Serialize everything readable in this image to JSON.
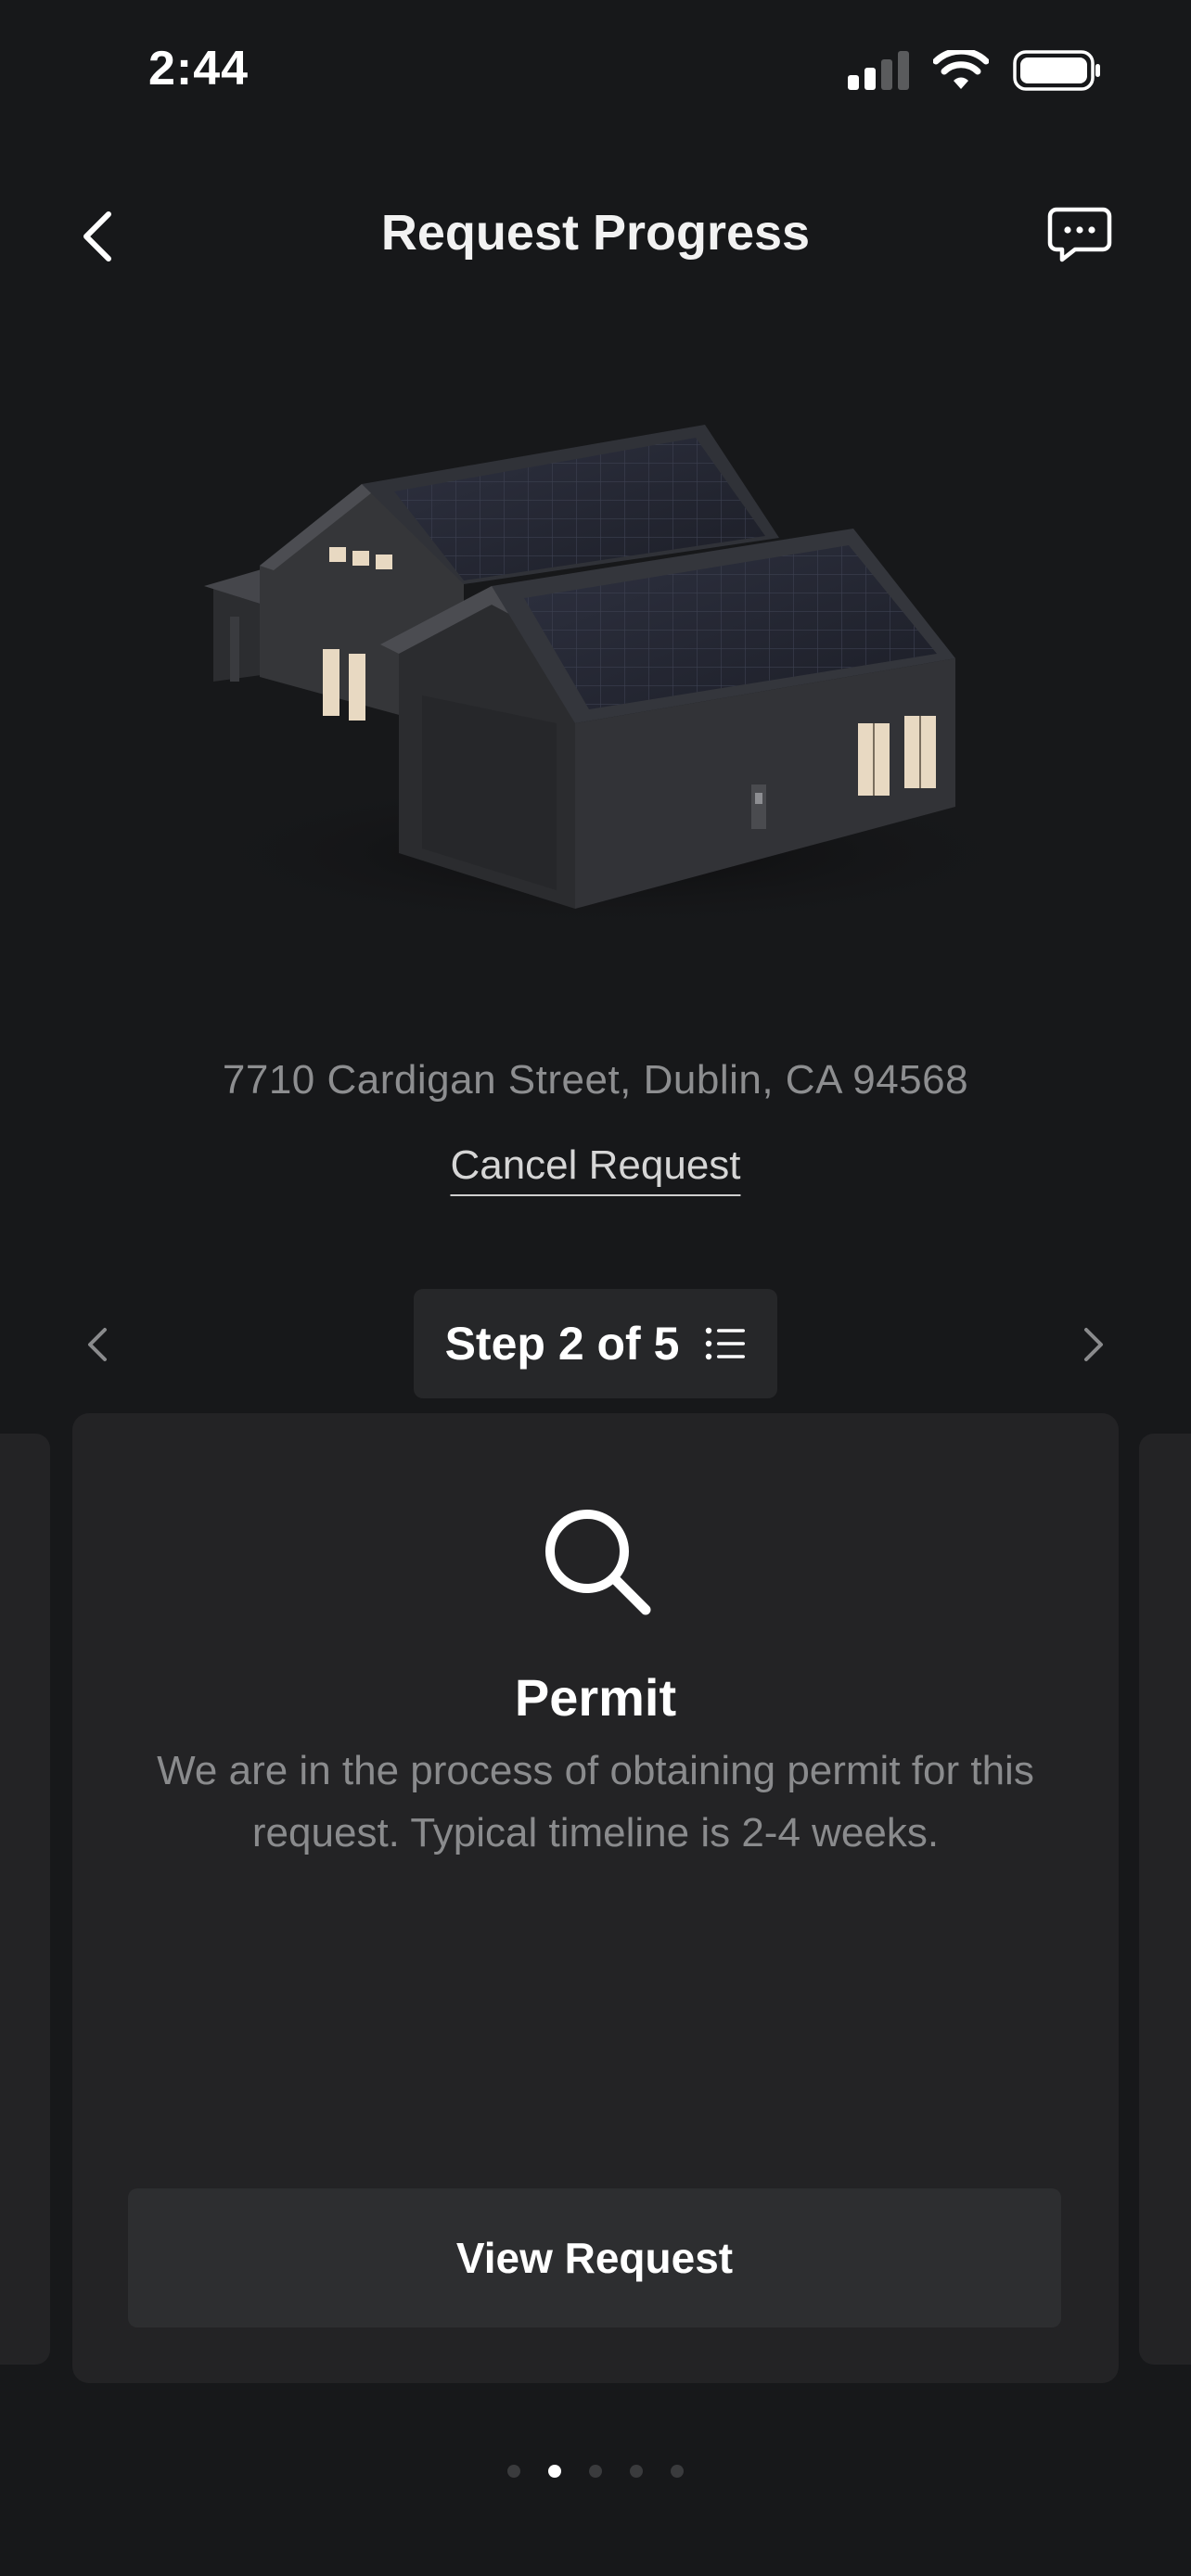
{
  "status_bar": {
    "time": "2:44",
    "icons": [
      "cellular-signal-icon",
      "wifi-icon",
      "battery-icon"
    ]
  },
  "header": {
    "title": "Request Progress",
    "back_icon": "chevron-left-icon",
    "chat_icon": "chat-bubble-icon"
  },
  "property": {
    "address": "7710 Cardigan Street, Dublin, CA 94568",
    "cancel_label": "Cancel Request"
  },
  "stepper": {
    "label": "Step 2 of 5",
    "current_step": 2,
    "total_steps": 5,
    "list_icon": "list-icon"
  },
  "current_card": {
    "icon": "search-icon",
    "title": "Permit",
    "description": "We are in the process of obtaining permit for this request. Typical timeline is 2-4 weeks.",
    "button_label": "View Request"
  },
  "pagination": {
    "total": 5,
    "active_index": 1
  },
  "colors": {
    "background": "#17181a",
    "card": "#232325",
    "button": "#2d2e30",
    "muted_text": "#8a8b8d"
  }
}
